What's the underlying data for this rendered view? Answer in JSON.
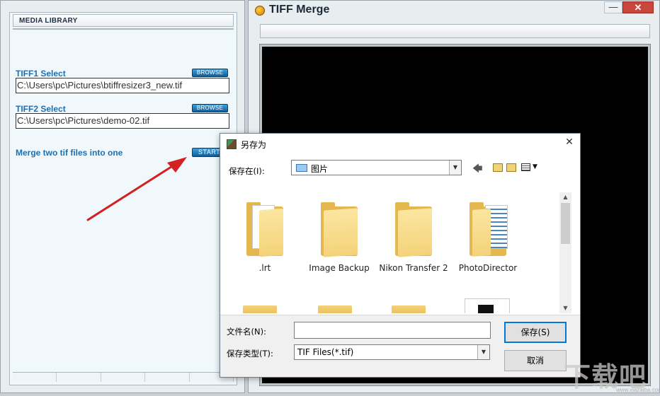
{
  "left_panel": {
    "header": "MEDIA LIBRARY",
    "tiff1_label": "TIFF1 Select",
    "tiff1_path": "C:\\Users\\pc\\Pictures\\btiffresizer3_new.tif",
    "tiff2_label": "TIFF2 Select",
    "tiff2_path": "C:\\Users\\pc\\Pictures\\demo-02.tif",
    "browse_label": "BROWSE",
    "merge_label": "Merge two tif files into one",
    "start_label": "START"
  },
  "right_panel": {
    "title": "TIFF Merge",
    "minimize_glyph": "—",
    "close_glyph": "✕"
  },
  "dialog": {
    "title": "另存为",
    "close_glyph": "✕",
    "save_in_label": "保存在(I):",
    "location": "图片",
    "items": [
      {
        "name": ".lrt"
      },
      {
        "name": "Image Backup"
      },
      {
        "name": "Nikon Transfer 2"
      },
      {
        "name": "PhotoDirector"
      }
    ],
    "filename_label": "文件名(N):",
    "filename_value": "",
    "filetype_label": "保存类型(T):",
    "filetype_value": "TIF Files(*.tif)",
    "save_button": "保存(S)",
    "cancel_button": "取消",
    "back_glyph": "🡄"
  },
  "watermark": {
    "text": "下载吧",
    "url": "www.xiazaiba.com"
  },
  "colors": {
    "accent_blue": "#1f6fb0",
    "button_blue": "#0f5e9d",
    "arrow_red": "#d42020",
    "folder_yellow": "#f4d27a"
  }
}
